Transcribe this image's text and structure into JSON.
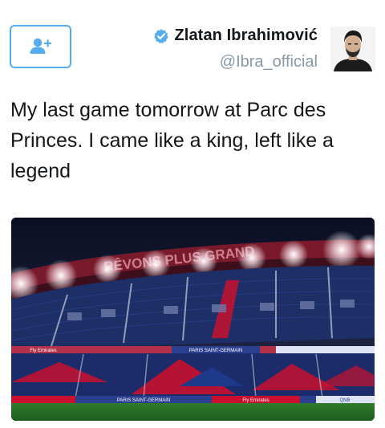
{
  "follow_button": {
    "icon": "add-user-icon",
    "accent": "#55acee"
  },
  "user": {
    "display_name": "Zlatan Ibrahimović",
    "handle": "@Ibra_official",
    "verified_icon": "verified-badge-icon",
    "verified_color": "#55acee"
  },
  "tweet": {
    "text": "My last game tomorrow at Parc des Princes. I came like a king, left like a legend"
  },
  "media": {
    "stadium_banner": "RÊVONS PLUS GRAND",
    "ad_boards": [
      "Fly Emirates",
      "PARIS SAINT-GERMAIN",
      "PARIS SAINT-GERMAIN",
      "Fly Emirates",
      "QNB"
    ],
    "colors": {
      "psg_blue": "#1d3a8a",
      "psg_red": "#c8102e",
      "pitch": "#2f7d2c"
    }
  }
}
